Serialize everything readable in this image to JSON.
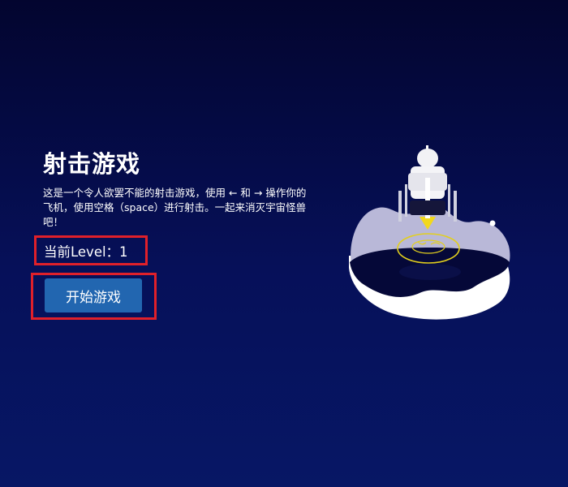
{
  "title": "射击游戏",
  "description": "这是一个令人欲罢不能的射击游戏，使用 ← 和 → 操作你的飞机，使用空格（space）进行射击。一起来消灭宇宙怪兽吧！",
  "level": {
    "text": "当前Level：1"
  },
  "start_button": {
    "label": "开始游戏"
  },
  "illustration": {
    "icon": "rocket-planet-illustration"
  },
  "colors": {
    "background_top": "#03052f",
    "background_bottom": "#071765",
    "button": "#2266b0",
    "highlight_border": "#e0202a",
    "beam": "#f2d81c"
  }
}
